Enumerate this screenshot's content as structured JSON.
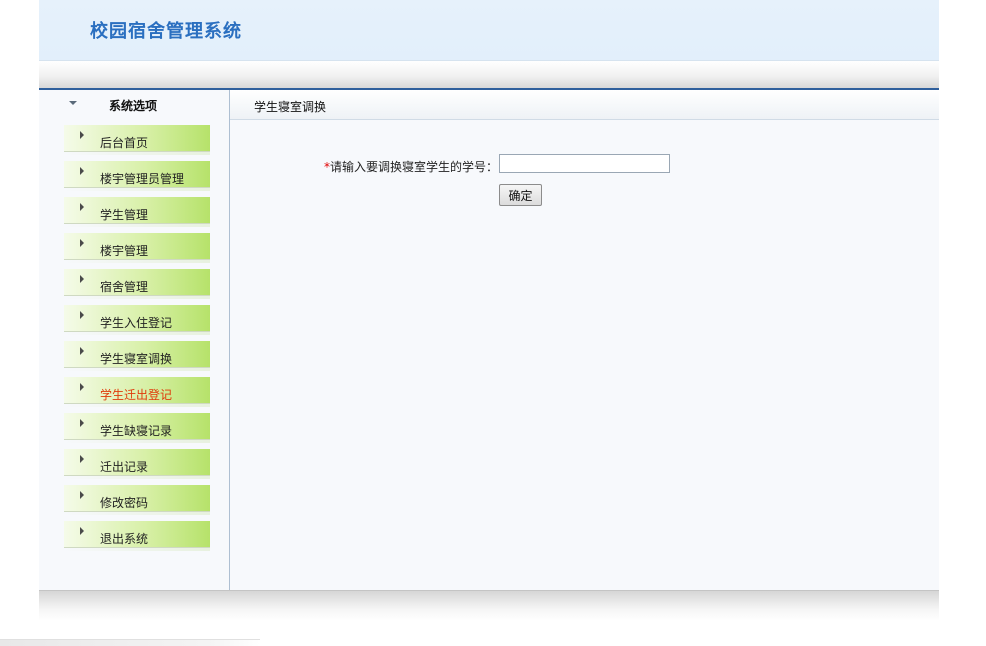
{
  "header": {
    "title": "校园宿舍管理系统"
  },
  "sidebar": {
    "title": "系统选项",
    "items": [
      {
        "label": "后台首页"
      },
      {
        "label": "楼宇管理员管理"
      },
      {
        "label": "学生管理"
      },
      {
        "label": "楼宇管理"
      },
      {
        "label": "宿舍管理"
      },
      {
        "label": "学生入住登记"
      },
      {
        "label": "学生寝室调换"
      },
      {
        "label": "学生迁出登记"
      },
      {
        "label": "学生缺寝记录"
      },
      {
        "label": "迁出记录"
      },
      {
        "label": "修改密码"
      },
      {
        "label": "退出系统"
      }
    ]
  },
  "main": {
    "breadcrumb": "学生寝室调换",
    "form": {
      "required_mark": "*",
      "label": "请输入要调换寝室学生的学号：",
      "student_id_value": "",
      "submit_label": "确定"
    }
  },
  "colors": {
    "title_blue": "#2a6fc0",
    "highlight_item": "#e03a0a",
    "menu_green": "#b6e26a",
    "required_red": "#e00000"
  }
}
